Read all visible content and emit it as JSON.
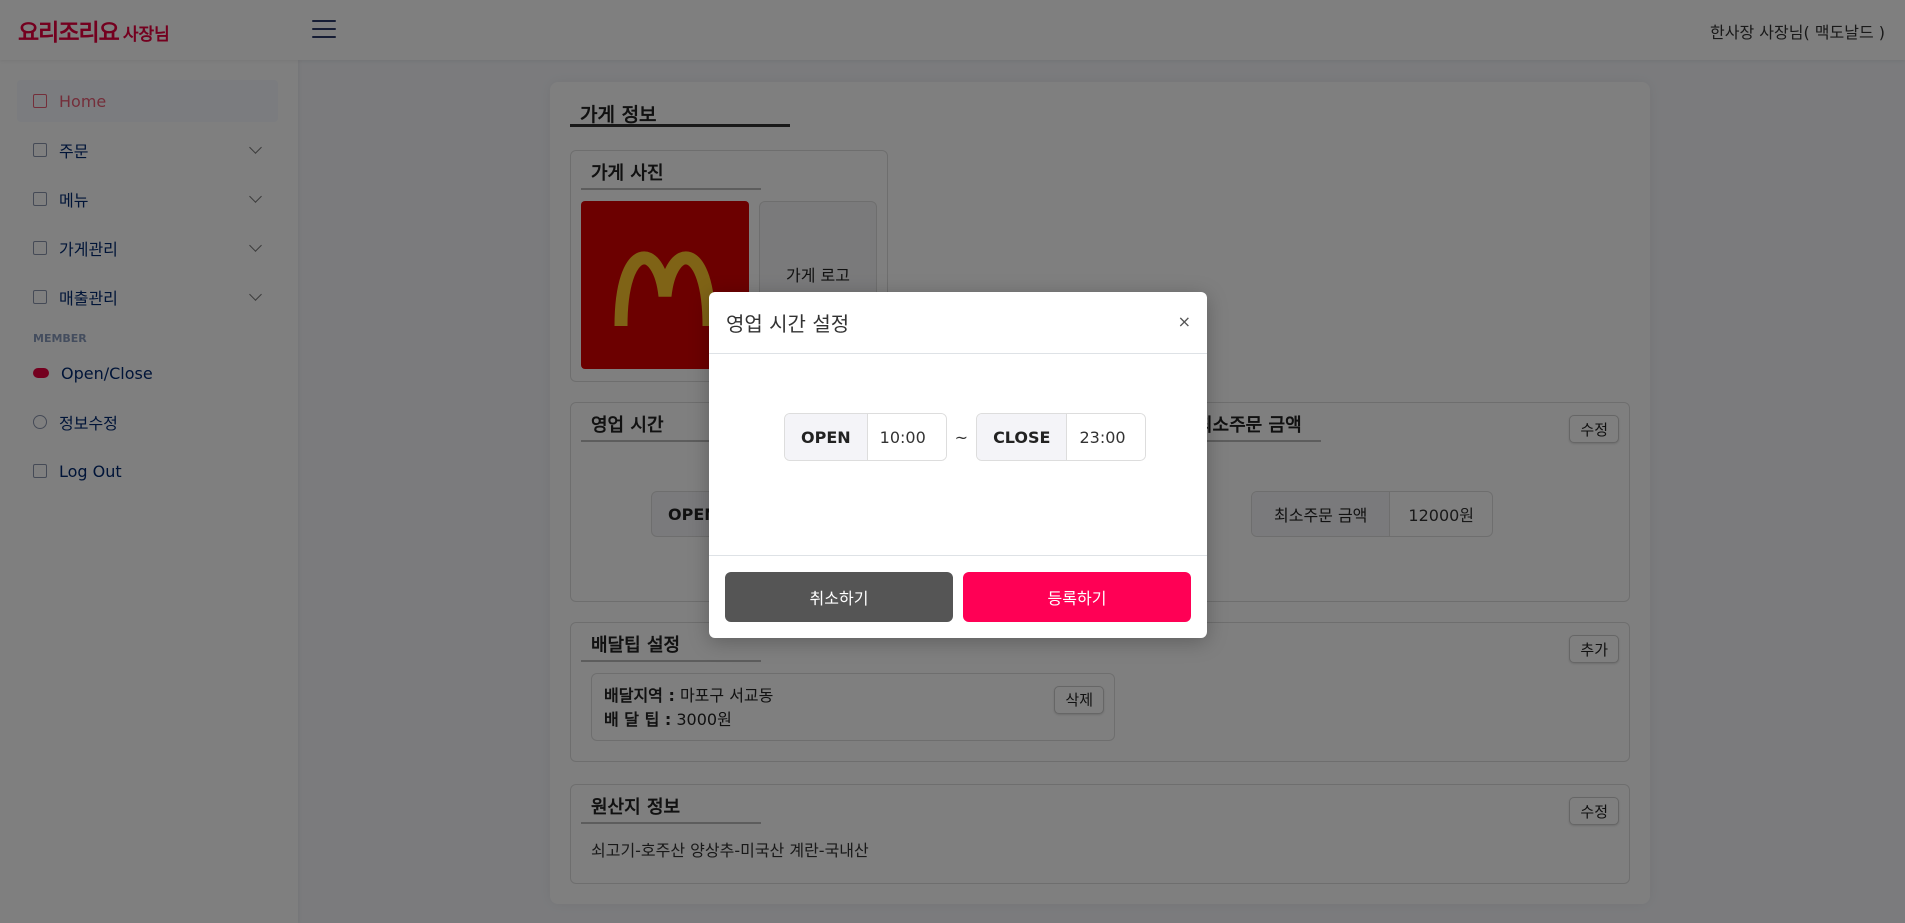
{
  "header": {
    "logo_main": "요리조리요",
    "logo_sub": "사장님",
    "user": "한사장 사장님( 맥도날드 )"
  },
  "sidebar": {
    "items": [
      {
        "label": "Home",
        "icon": "grid-icon"
      },
      {
        "label": "주문",
        "icon": "orders-icon"
      },
      {
        "label": "메뉴",
        "icon": "menu-icon"
      },
      {
        "label": "가게관리",
        "icon": "store-icon"
      },
      {
        "label": "매출관리",
        "icon": "chart-icon"
      }
    ],
    "section_heading": "MEMBER",
    "member_items": [
      {
        "label": "Open/Close",
        "icon": "toggle-icon"
      },
      {
        "label": "정보수정",
        "icon": "person-icon"
      },
      {
        "label": "Log Out",
        "icon": "logout-icon"
      }
    ]
  },
  "page": {
    "title": "가게 정보",
    "photo": {
      "title": "가게 사진",
      "logo_placeholder": "가게 로고"
    },
    "hours": {
      "title": "영업 시간",
      "open_label": "OPEN"
    },
    "min_order": {
      "title": "최소주문 금액",
      "edit_label": "수정",
      "label": "최소주문 금액",
      "value": "12000원"
    },
    "delivery_tip": {
      "title": "배달팁 설정",
      "add_label": "추가",
      "area_label": "배달지역 :",
      "area_value": "마포구 서교동",
      "tip_label": "배 달 팁 :",
      "tip_value": "3000원",
      "delete_label": "삭제"
    },
    "origin": {
      "title": "원산지 정보",
      "edit_label": "수정",
      "text": "쇠고기-호주산 양상추-미국산 계란-국내산"
    }
  },
  "modal": {
    "title": "영업 시간 설정",
    "close": "×",
    "open_label": "OPEN",
    "open_value": "10:00",
    "tilde": "~",
    "close_label": "CLOSE",
    "close_value": "23:00",
    "cancel_label": "취소하기",
    "submit_label": "등록하기"
  }
}
